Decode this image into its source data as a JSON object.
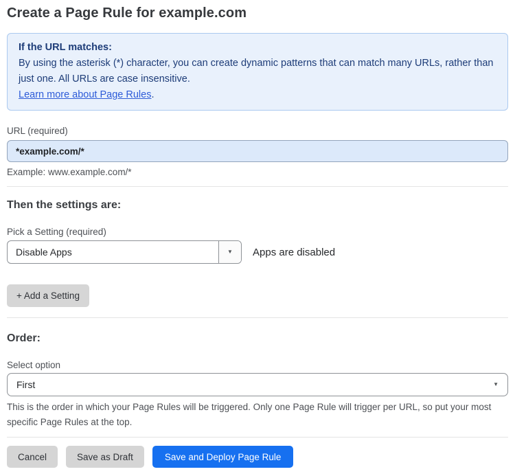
{
  "page": {
    "title": "Create a Page Rule for example.com"
  },
  "info_box": {
    "heading": "If the URL matches:",
    "body": "By using the asterisk (*) character, you can create dynamic patterns that can match many URLs, rather than just one. All URLs are case insensitive.",
    "link_label": "Learn more about Page Rules",
    "link_suffix": "."
  },
  "url_field": {
    "label": "URL (required)",
    "value": "*example.com/*",
    "example": "Example: www.example.com/*"
  },
  "settings_section": {
    "heading": "Then the settings are:",
    "setting_label": "Pick a Setting (required)",
    "setting_value": "Disable Apps",
    "setting_status": "Apps are disabled",
    "add_setting_label": "+ Add a Setting"
  },
  "order_section": {
    "heading": "Order:",
    "select_label": "Select option",
    "select_value": "First",
    "help_text": "This is the order in which your Page Rules will be triggered. Only one Page Rule will trigger per URL, so put your most specific Page Rules at the top."
  },
  "footer": {
    "cancel_label": "Cancel",
    "save_draft_label": "Save as Draft",
    "save_deploy_label": "Save and Deploy Page Rule"
  },
  "icons": {
    "dropdown_caret": "▼"
  },
  "colors": {
    "accent_blue": "#1670f0",
    "info_bg": "#e9f1fc",
    "info_border": "#abc9ef",
    "info_text": "#1d3c78",
    "link_blue": "#2d5bd8",
    "url_input_bg": "#dce9fa",
    "button_gray": "#d5d5d5"
  }
}
